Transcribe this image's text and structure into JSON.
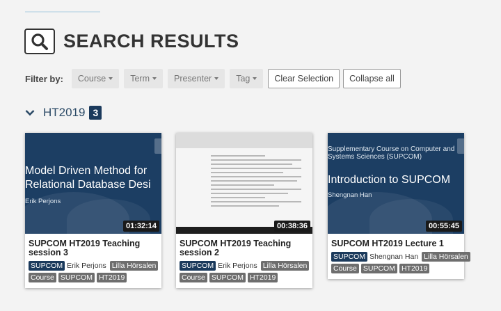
{
  "header": {
    "title": "SEARCH RESULTS"
  },
  "filters": {
    "label": "Filter by:",
    "dropdowns": [
      "Course",
      "Term",
      "Presenter",
      "Tag"
    ],
    "clear_label": "Clear Selection",
    "collapse_label": "Collapse all"
  },
  "group": {
    "name": "HT2019",
    "count": "3"
  },
  "colors": {
    "accent": "#1b3a5c",
    "thumb_bg": "#1c3e63",
    "tag_grey": "#6e6e6e"
  },
  "cards": [
    {
      "thumb_title": "Model Driven Method for Relational Database Desi",
      "thumb_title_line1": "Model Driven Method for",
      "thumb_title_line2": "Relational Database Desi",
      "thumb_sub": "Erik Perjons",
      "duration": "01:32:14",
      "title": "SUPCOM HT2019 Teaching session 3",
      "course_tag": "SUPCOM",
      "presenters": [
        "Erik Perjons",
        "Lilla Hörsalen"
      ],
      "tags": [
        "Course",
        "SUPCOM",
        "HT2019"
      ]
    },
    {
      "thumb_title": "",
      "duration": "00:38:36",
      "title": "SUPCOM HT2019 Teaching session 2",
      "course_tag": "SUPCOM",
      "presenters": [
        "Erik Perjons",
        "Lilla Hörsalen"
      ],
      "tags": [
        "Course",
        "SUPCOM",
        "HT2019"
      ]
    },
    {
      "thumb_small_line1": "Supplementary Course on Computer and",
      "thumb_small_line2": "Systems Sciences (SUPCOM)",
      "thumb_title": "Introduction to SUPCOM",
      "thumb_sub": "Shengnan Han",
      "duration": "00:55:45",
      "title": "SUPCOM HT2019 Lecture 1",
      "course_tag": "SUPCOM",
      "presenters": [
        "Shengnan Han",
        "Lilla Hörsalen"
      ],
      "tags": [
        "Course",
        "SUPCOM",
        "HT2019"
      ]
    }
  ]
}
